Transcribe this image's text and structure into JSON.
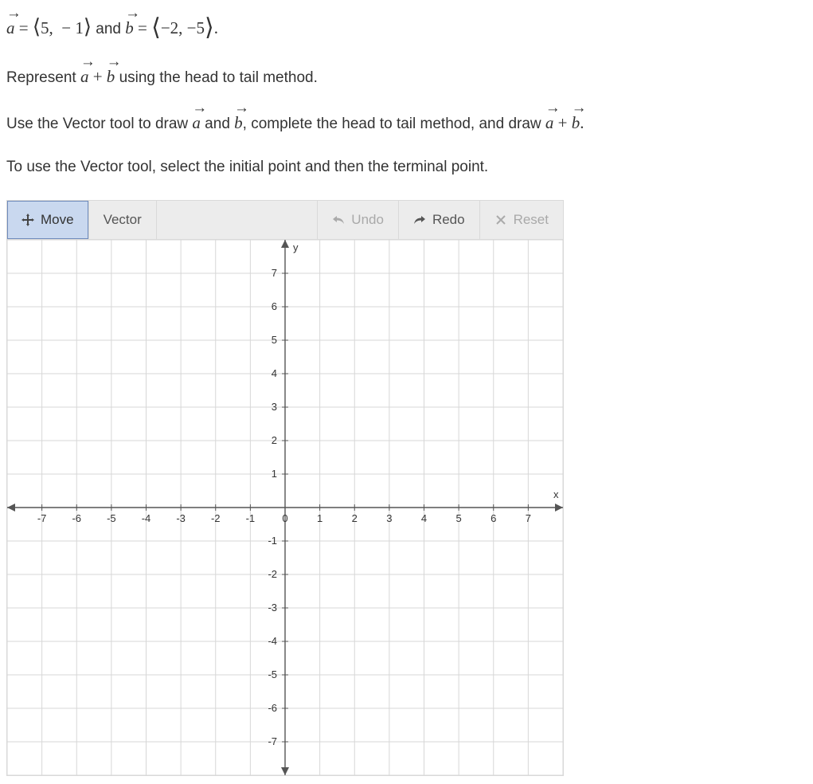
{
  "problem": {
    "line1_prefix": " = ",
    "vec_a_val": "⟨5,  − 1⟩",
    "line1_mid": " and ",
    "vec_b_val": "−2, −5",
    "line2_pre": "Represent ",
    "line2_post": " using the head to tail method.",
    "line3_pre": "Use the Vector tool to draw ",
    "line3_mid": " and ",
    "line3_mid2": ", complete the head to tail method, and draw ",
    "line4": "To use the Vector tool, select the initial point and then the terminal point.",
    "a": "a",
    "b": "b",
    "plus": " + "
  },
  "toolbar": {
    "move": "Move",
    "vector": "Vector",
    "undo": "Undo",
    "redo": "Redo",
    "reset": "Reset"
  },
  "chart_data": {
    "type": "scatter",
    "title": "",
    "xlabel": "x",
    "ylabel": "y",
    "xlim": [
      -8,
      8
    ],
    "ylim": [
      -8,
      8
    ],
    "x_ticks": [
      -7,
      -6,
      -5,
      -4,
      -3,
      -2,
      -1,
      0,
      1,
      2,
      3,
      4,
      5,
      6,
      7
    ],
    "y_ticks": [
      -7,
      -6,
      -5,
      -4,
      -3,
      -2,
      -1,
      1,
      2,
      3,
      4,
      5,
      6,
      7
    ],
    "series": [],
    "grid": true
  }
}
